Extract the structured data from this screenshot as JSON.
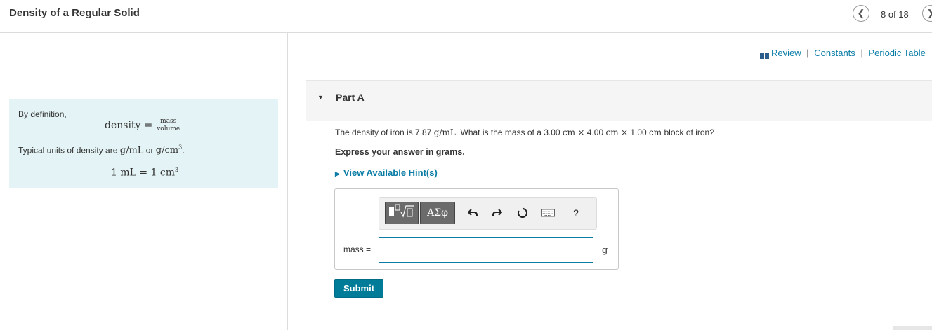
{
  "header": {
    "title": "Density of a Regular Solid",
    "page_counter": "8 of 18"
  },
  "intro": {
    "by_definition": "By definition,",
    "density_word": "density",
    "equals": "=",
    "numerator": "mass",
    "denominator": "volume",
    "units_prefix": "Typical units of density are",
    "unit_gml": "g/mL",
    "or": "or",
    "unit_gcm": "g/cm",
    "exp3": "3",
    "period": ".",
    "ml_equation": "1 mL = 1 cm",
    "ml_exp": "3"
  },
  "resources": {
    "review": "Review",
    "constants": "Constants",
    "periodic_table": "Periodic Table",
    "separator": "|"
  },
  "part": {
    "label": "Part A"
  },
  "question": {
    "p1": "The density of iron is 7.87",
    "u1": "g/mL",
    "p2": ". What is the mass of a 3.00",
    "u2": "cm",
    "x1": "×",
    "p3": "4.00",
    "u3": "cm",
    "x2": "×",
    "p4": "1.00",
    "u4": "cm",
    "p5": "block of iron?"
  },
  "instruction": "Express your answer in grams.",
  "hints": "View Available Hint(s)",
  "answer": {
    "label": "mass =",
    "value": "",
    "unit": "g",
    "symbols_label": "ΑΣφ",
    "help": "?"
  },
  "submit": "Submit",
  "colors": {
    "accent": "#0a7ca6",
    "submit_bg": "#007c99",
    "intro_bg": "#e4f3f5"
  }
}
